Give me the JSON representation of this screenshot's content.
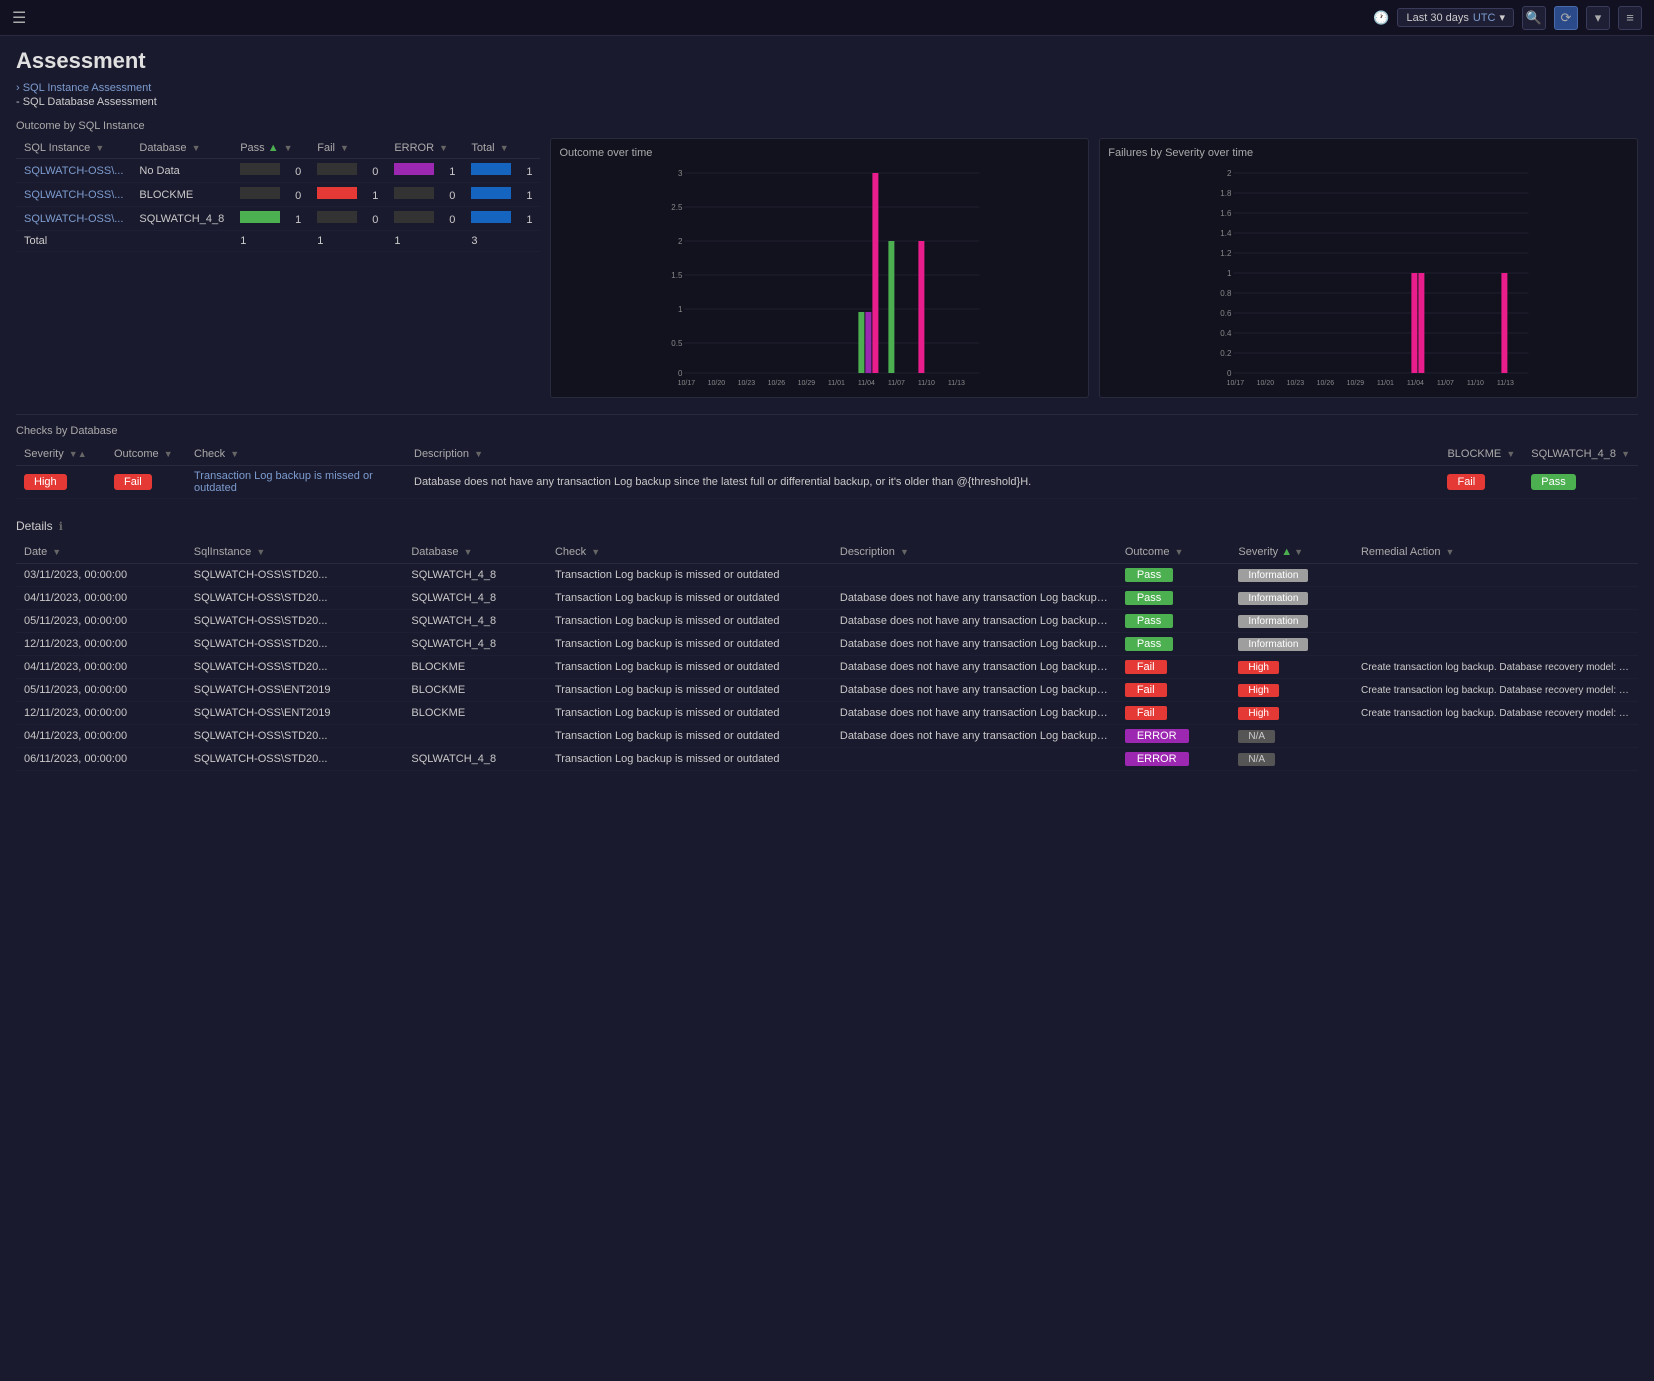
{
  "topbar": {
    "hamburger": "☰",
    "time_range": "Last 30 days",
    "timezone": "UTC",
    "icons": [
      "🔍",
      "⟳",
      "▾",
      "≡"
    ]
  },
  "page": {
    "title": "Assessment",
    "breadcrumbs": [
      {
        "label": "› SQL Instance Assessment",
        "active": false
      },
      {
        "label": "- SQL Database Assessment",
        "active": true
      }
    ]
  },
  "outcome_section": {
    "title": "Outcome by SQL Instance",
    "columns": [
      "SQL Instance",
      "Database",
      "Pass",
      "Fail",
      "ERROR",
      "Total"
    ],
    "rows": [
      {
        "sql_instance": "SQLWATCH-OSS\\...",
        "database": "No Data",
        "pass": 0,
        "fail": 0,
        "error": 1,
        "total": 1
      },
      {
        "sql_instance": "SQLWATCH-OSS\\...",
        "database": "BLOCKME",
        "pass": 0,
        "fail": 1,
        "error": 0,
        "total": 1
      },
      {
        "sql_instance": "SQLWATCH-OSS\\...",
        "database": "SQLWATCH_4_8",
        "pass": 1,
        "fail": 0,
        "error": 0,
        "total": 1
      }
    ],
    "total_row": {
      "pass": 1,
      "fail": 1,
      "error": 1,
      "total": 3
    }
  },
  "outcome_over_time": {
    "title": "Outcome over time",
    "x_labels": [
      "10/17",
      "10/20",
      "10/23",
      "10/26",
      "10/29",
      "11/01",
      "11/04",
      "11/07",
      "11/10",
      "11/13"
    ],
    "y_labels": [
      "0",
      "0.5",
      "1",
      "1.5",
      "2",
      "2.5",
      "3"
    ]
  },
  "failures_over_time": {
    "title": "Failures by Severity over time",
    "x_labels": [
      "10/17",
      "10/20",
      "10/23",
      "10/26",
      "10/29",
      "11/01",
      "11/04",
      "11/07",
      "11/10",
      "11/13"
    ],
    "y_labels": [
      "0",
      "0.2",
      "0.4",
      "0.6",
      "0.8",
      "1",
      "1.2",
      "1.4",
      "1.6",
      "1.8",
      "2"
    ]
  },
  "checks_section": {
    "title": "Checks by Database",
    "columns": [
      "Severity",
      "Outcome",
      "Check",
      "Description",
      "BLOCKME",
      "SQLWATCH_4_8"
    ],
    "rows": [
      {
        "severity": "High",
        "outcome": "Fail",
        "check": "Transaction Log backup is missed or outdated",
        "description": "Database does not have any transaction Log backup since the latest full or differential backup, or it's older than @{threshold}H.",
        "blockme": "Fail",
        "sqlwatch_4_8": "Pass"
      }
    ]
  },
  "details_section": {
    "title": "Details",
    "columns": [
      "Date",
      "SqlInstance",
      "Database",
      "Check",
      "Description",
      "Outcome",
      "Severity",
      "Remedial Action"
    ],
    "rows": [
      {
        "date": "03/11/2023, 00:00:00",
        "sql_instance": "SQLWATCH-OSS\\STD20...",
        "database": "SQLWATCH_4_8",
        "check": "Transaction Log backup is missed or outdated",
        "description": "",
        "outcome": "Pass",
        "severity": "Information",
        "remedial": ""
      },
      {
        "date": "04/11/2023, 00:00:00",
        "sql_instance": "SQLWATCH-OSS\\STD20...",
        "database": "SQLWATCH_4_8",
        "check": "Transaction Log backup is missed or outdated",
        "description": "Database does not have any transaction Log backup since th...",
        "outcome": "Pass",
        "severity": "Information",
        "remedial": ""
      },
      {
        "date": "05/11/2023, 00:00:00",
        "sql_instance": "SQLWATCH-OSS\\STD20...",
        "database": "SQLWATCH_4_8",
        "check": "Transaction Log backup is missed or outdated",
        "description": "Database does not have any transaction Log backup since th...",
        "outcome": "Pass",
        "severity": "Information",
        "remedial": ""
      },
      {
        "date": "12/11/2023, 00:00:00",
        "sql_instance": "SQLWATCH-OSS\\STD20...",
        "database": "SQLWATCH_4_8",
        "check": "Transaction Log backup is missed or outdated",
        "description": "Database does not have any transaction Log backup since th...",
        "outcome": "Pass",
        "severity": "Information",
        "remedial": ""
      },
      {
        "date": "04/11/2023, 00:00:00",
        "sql_instance": "SQLWATCH-OSS\\STD20...",
        "database": "BLOCKME",
        "check": "Transaction Log backup is missed or outdated",
        "description": "Database does not have any transaction Log backup since th...",
        "outcome": "Fail",
        "severity": "High",
        "remedial": "Create transaction log backup. Database recovery model: FULL"
      },
      {
        "date": "05/11/2023, 00:00:00",
        "sql_instance": "SQLWATCH-OSS\\ENT2019",
        "database": "BLOCKME",
        "check": "Transaction Log backup is missed or outdated",
        "description": "Database does not have any transaction Log backup since th...",
        "outcome": "Fail",
        "severity": "High",
        "remedial": "Create transaction log backup. Database recovery model: FULL"
      },
      {
        "date": "12/11/2023, 00:00:00",
        "sql_instance": "SQLWATCH-OSS\\ENT2019",
        "database": "BLOCKME",
        "check": "Transaction Log backup is missed or outdated",
        "description": "Database does not have any transaction Log backup since th...",
        "outcome": "Fail",
        "severity": "High",
        "remedial": "Create transaction log backup. Database recovery model: FULL"
      },
      {
        "date": "04/11/2023, 00:00:00",
        "sql_instance": "SQLWATCH-OSS\\STD20...",
        "database": "",
        "check": "Transaction Log backup is missed or outdated",
        "description": "Database does not have any transaction Log backup since th...",
        "outcome": "ERROR",
        "severity": "N/A",
        "remedial": ""
      },
      {
        "date": "06/11/2023, 00:00:00",
        "sql_instance": "SQLWATCH-OSS\\STD20...",
        "database": "SQLWATCH_4_8",
        "check": "Transaction Log backup is missed or outdated",
        "description": "",
        "outcome": "ERROR",
        "severity": "N/A",
        "remedial": ""
      }
    ]
  }
}
